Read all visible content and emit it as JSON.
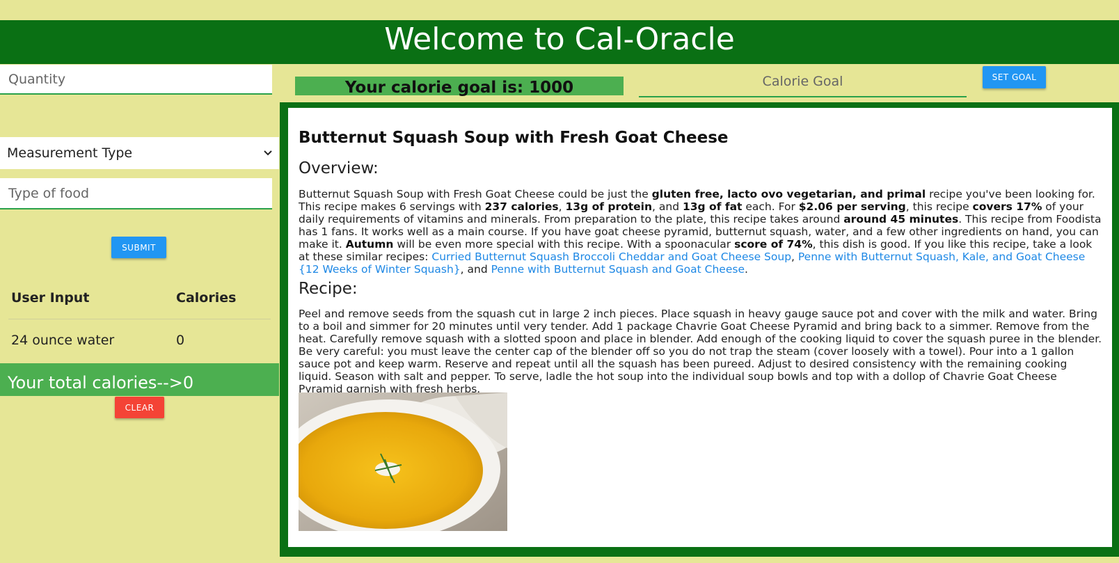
{
  "header": {
    "title": "Welcome to Cal-Oracle"
  },
  "form": {
    "quantity_placeholder": "Quantity",
    "measurement_selected": "Measurement Type",
    "food_placeholder": "Type of food",
    "submit_label": "SUBMIT",
    "clear_label": "CLEAR"
  },
  "table": {
    "headers": [
      "User Input",
      "Calories"
    ],
    "rows": [
      {
        "input": "24 ounce water",
        "calories": "0"
      }
    ]
  },
  "total": {
    "text": "Your total calories-->0"
  },
  "goal": {
    "display": "Your calorie goal is: 1000",
    "input_placeholder": "Calorie Goal",
    "set_label": "SET GOAL"
  },
  "recipe": {
    "title": "Butternut Squash Soup with Fresh Goat Cheese",
    "overview_heading": "Overview:",
    "overview": {
      "t1": "Butternut Squash Soup with Fresh Goat Cheese could be just the ",
      "b1": "gluten free, lacto ovo vegetarian, and primal",
      "t2": " recipe you've been looking for. This recipe makes 6 servings with ",
      "b2": "237 calories",
      "t3": ", ",
      "b3": "13g of protein",
      "t4": ", and ",
      "b4": "13g of fat",
      "t5": " each. For ",
      "b5": "$2.06 per serving",
      "t6": ", this recipe ",
      "b6": "covers 17%",
      "t7": " of your daily requirements of vitamins and minerals. From preparation to the plate, this recipe takes around ",
      "b7": "around 45 minutes",
      "t8": ". This recipe from Foodista has 1 fans. It works well as a main course. If you have goat cheese pyramid, butternut squash, water, and a few other ingredients on hand, you can make it. ",
      "b8": "Autumn",
      "t9": " will be even more special with this recipe. With a spoonacular ",
      "b9": "score of 74%",
      "t10": ", this dish is good. If you like this recipe, take a look at these similar recipes: ",
      "l1": "Curried Butternut Squash Broccoli Cheddar and Goat Cheese Soup",
      "t11": ", ",
      "l2": "Penne with Butternut Squash, Kale, and Goat Cheese {12 Weeks of Winter Squash}",
      "t12": ", and ",
      "l3": "Penne with Butternut Squash and Goat Cheese",
      "t13": "."
    },
    "recipe_heading": "Recipe:",
    "instructions": "Peel and remove seeds from the squash cut in large 2 inch pieces. Place squash in heavy gauge sauce pot and cover with the milk and water. Bring to a boil and simmer for 20 minutes until very tender. Add 1 package Chavrie Goat Cheese Pyramid and bring back to a simmer. Remove from the heat. Carefully remove squash with a slotted spoon and place in blender. Add enough of the cooking liquid to cover the squash puree in the blender. Be very careful: you must leave the center cap of the blender off so you do not trap the steam (cover loosely with a towel). Pour into a 1 gallon sauce pot and keep warm. Reserve and repeat until all the squash has been pureed. Adjust to desired consistency with the remaining cooking liquid. Season with salt and pepper. To serve, ladle the hot soup into the individual soup bowls and top with a dollop of Chavrie Goat Cheese Pyramid garnish with fresh herbs."
  },
  "colors": {
    "background": "#e6e696",
    "header": "#0a7014",
    "accent_green": "#4caf50",
    "button_blue": "#2196f3",
    "button_red": "#f44336",
    "link": "#1e88e5"
  }
}
